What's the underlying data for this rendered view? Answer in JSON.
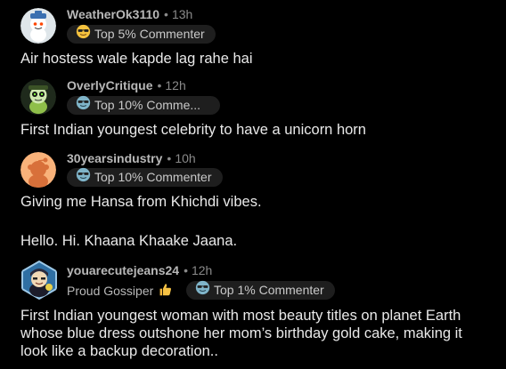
{
  "comments": [
    {
      "username": "WeatherOk3110",
      "time": "13h",
      "badge": "Top 5% Commenter",
      "badge_icon": "sunglasses-emoji-icon",
      "text": "Air hostess wale kapde lag rahe hai"
    },
    {
      "username": "OverlyCritique",
      "time": "12h",
      "badge": "Top 10% Comme...",
      "badge_icon": "sunglasses-emoji-icon",
      "text": "First Indian youngest celebrity to have a unicorn horn"
    },
    {
      "username": "30yearsindustry",
      "time": "10h",
      "badge": "Top 10% Commenter",
      "badge_icon": "sunglasses-emoji-icon",
      "text_lines": [
        "Giving me Hansa from Khichdi vibes.",
        "Hello. Hi. Khaana Khaake Jaana."
      ]
    },
    {
      "username": "youarecutejeans24",
      "time": "12h",
      "flair": "Proud Gossiper",
      "flair_icon": "thumbs-up-emoji-icon",
      "badge": "Top 1% Commenter",
      "badge_icon": "sunglasses-emoji-icon",
      "text": "First Indian youngest woman with most beauty titles on planet Earth whose blue dress outshone her mom’s birthday gold cake, making it look like a backup decoration.."
    }
  ],
  "separator": "•",
  "colors": {
    "background": "#000000",
    "username": "#b8b8b8",
    "meta": "#8a8a8a",
    "body": "#e9e9e9",
    "badge_bg": "#1e1e1e"
  }
}
